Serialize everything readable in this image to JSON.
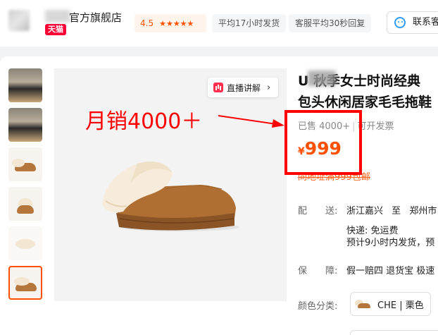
{
  "header": {
    "store_name": "官方旗舰店",
    "tmall_badge": "天猫",
    "rating": "4.5",
    "stars": "★★★★★",
    "tags": [
      "平均17小时发货",
      "客服平均30秒回复"
    ],
    "contact_label": "联系客服"
  },
  "media": {
    "live_label": "直播讲解",
    "live_chevron": "›"
  },
  "annotation": {
    "text": "月销4000＋",
    "color": "#ff0000"
  },
  "product": {
    "title_line1": "U  秋季女士时尚经典",
    "title_line2": "包头休闲居家毛毛拖鞋",
    "sold_label": "已售 4000+",
    "invoice_label": "可开发票",
    "price_symbol": "¥",
    "price": "999",
    "promo": "同地址满999包邮"
  },
  "shipping": {
    "label": "配　　送:",
    "route_from": "浙江嘉兴",
    "route_to_word": "至",
    "route_to": "郑州市",
    "express": "快递: 免运费",
    "eta": "预计9小时内发货，预"
  },
  "guarantee": {
    "label": "保　　障:",
    "value": "假一赔四 退货宝 极速"
  },
  "color": {
    "label": "颜色分类:",
    "option": "CHE | 栗色"
  },
  "colors": {
    "accent": "#ff5000",
    "tmall_red": "#ff0036",
    "annotation_red": "#ff0000"
  }
}
